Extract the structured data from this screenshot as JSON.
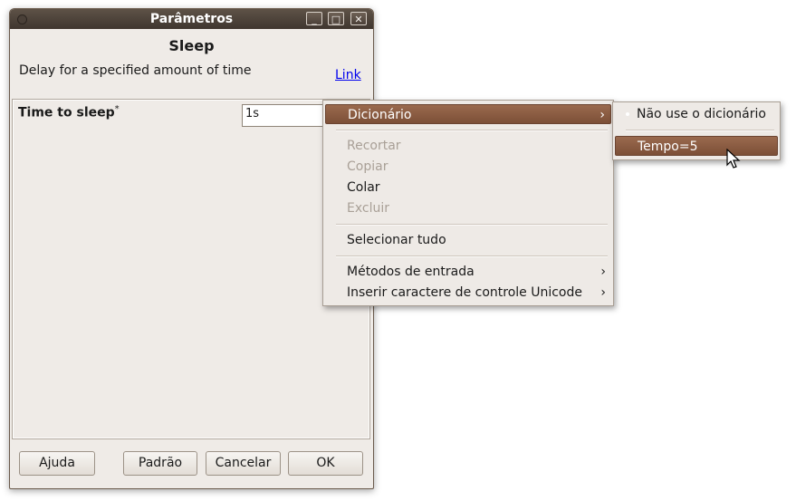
{
  "window": {
    "title": "Parâmetros",
    "heading": "Sleep",
    "description": "Delay for a specified amount of time",
    "help_link": "Link",
    "controls": {
      "minimize": "_",
      "maximize": "□",
      "close": "✕"
    }
  },
  "parameter": {
    "label": "Time to sleep",
    "required_mark": "*",
    "value": "1s"
  },
  "buttons": {
    "help": "Ajuda",
    "default": "Padrão",
    "cancel": "Cancelar",
    "ok": "OK"
  },
  "context_menu": {
    "items": [
      {
        "label": "Dicionário",
        "state": "active",
        "submenu": true
      },
      {
        "label": "Recortar",
        "state": "disabled"
      },
      {
        "label": "Copiar",
        "state": "disabled"
      },
      {
        "label": "Colar",
        "state": "enabled"
      },
      {
        "label": "Excluir",
        "state": "disabled"
      },
      {
        "label": "Selecionar tudo",
        "state": "enabled"
      },
      {
        "label": "Métodos de entrada",
        "state": "enabled",
        "submenu": true
      },
      {
        "label": "Inserir caractere de controle Unicode",
        "state": "enabled",
        "submenu": true
      }
    ]
  },
  "dictionary_submenu": {
    "items": [
      {
        "label": "Não use o dicionário",
        "state": "selected"
      },
      {
        "label": "Tempo=5",
        "state": "hovered"
      }
    ]
  },
  "colors": {
    "titlebar": "#3f362f",
    "menu_highlight": "#8a5a41",
    "window_bg": "#efebe7"
  }
}
